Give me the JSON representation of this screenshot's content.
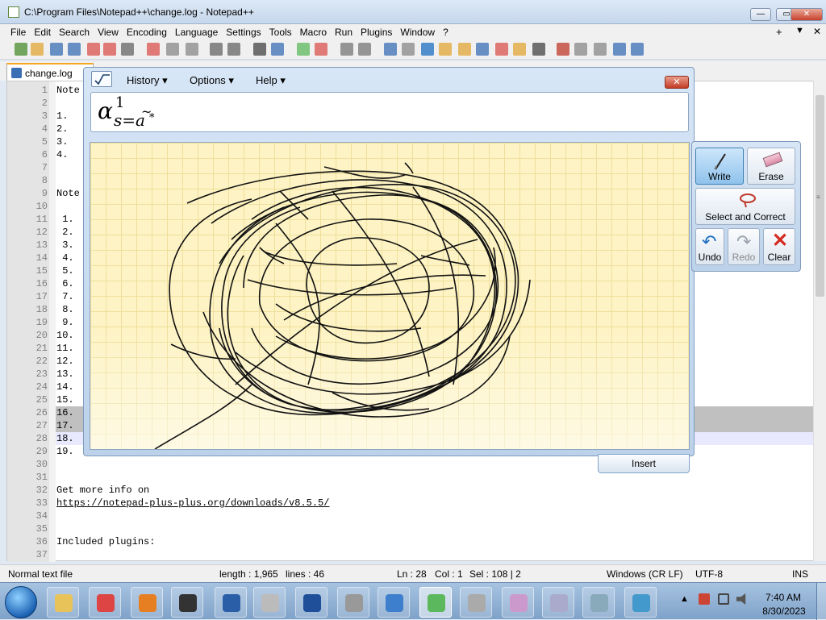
{
  "notepad": {
    "title": "C:\\Program Files\\Notepad++\\change.log - Notepad++",
    "menu": [
      "File",
      "Edit",
      "Search",
      "View",
      "Encoding",
      "Language",
      "Settings",
      "Tools",
      "Macro",
      "Run",
      "Plugins",
      "Window",
      "?"
    ],
    "menu_right": [
      "+",
      "▼",
      "✕"
    ],
    "tab_label": "change.log",
    "lines": [
      {
        "n": "1",
        "text": "Note"
      },
      {
        "n": "2",
        "text": ""
      },
      {
        "n": "3",
        "text": "1."
      },
      {
        "n": "4",
        "text": "2."
      },
      {
        "n": "5",
        "text": "3."
      },
      {
        "n": "6",
        "text": "4."
      },
      {
        "n": "7",
        "text": ""
      },
      {
        "n": "8",
        "text": ""
      },
      {
        "n": "9",
        "text": "Note"
      },
      {
        "n": "10",
        "text": ""
      },
      {
        "n": "11",
        "text": " 1."
      },
      {
        "n": "12",
        "text": " 2."
      },
      {
        "n": "13",
        "text": " 3."
      },
      {
        "n": "14",
        "text": " 4."
      },
      {
        "n": "15",
        "text": " 5."
      },
      {
        "n": "16",
        "text": " 6."
      },
      {
        "n": "17",
        "text": " 7."
      },
      {
        "n": "18",
        "text": " 8."
      },
      {
        "n": "19",
        "text": " 9."
      },
      {
        "n": "20",
        "text": "10."
      },
      {
        "n": "21",
        "text": "11."
      },
      {
        "n": "22",
        "text": "12."
      },
      {
        "n": "23",
        "text": "13."
      },
      {
        "n": "24",
        "text": "14."
      },
      {
        "n": "25",
        "text": "15."
      },
      {
        "n": "26",
        "text": "16."
      },
      {
        "n": "27",
        "text": "17."
      },
      {
        "n": "28",
        "text": "18."
      },
      {
        "n": "29",
        "text": "19."
      },
      {
        "n": "30",
        "text": ""
      },
      {
        "n": "31",
        "text": ""
      },
      {
        "n": "32",
        "text": "Get more info on"
      },
      {
        "n": "33",
        "text": "https://notepad-plus-plus.org/downloads/v8.5.5/"
      },
      {
        "n": "34",
        "text": ""
      },
      {
        "n": "35",
        "text": ""
      },
      {
        "n": "36",
        "text": "Included plugins:"
      },
      {
        "n": "37",
        "text": ""
      }
    ],
    "status": {
      "type": "Normal text file",
      "length": "length : 1,965",
      "lines": "lines : 46",
      "ln": "Ln : 28",
      "col": "Col : 1",
      "sel": "Sel : 108 | 2",
      "eol": "Windows (CR LF)",
      "encoding": "UTF-8",
      "mode": "INS"
    }
  },
  "math_panel": {
    "menu": [
      "History",
      "Options",
      "Help"
    ],
    "preview": {
      "base": "α",
      "sup": "1",
      "sub": "s=a",
      "sub_accent": "~",
      "sub_star": "*"
    },
    "tools": {
      "write": "Write",
      "erase": "Erase",
      "select": "Select and Correct",
      "undo": "Undo",
      "redo": "Redo",
      "clear": "Clear"
    },
    "insert": "Insert"
  },
  "taskbar": {
    "time": "7:40 AM",
    "date": "8/30/2023"
  }
}
